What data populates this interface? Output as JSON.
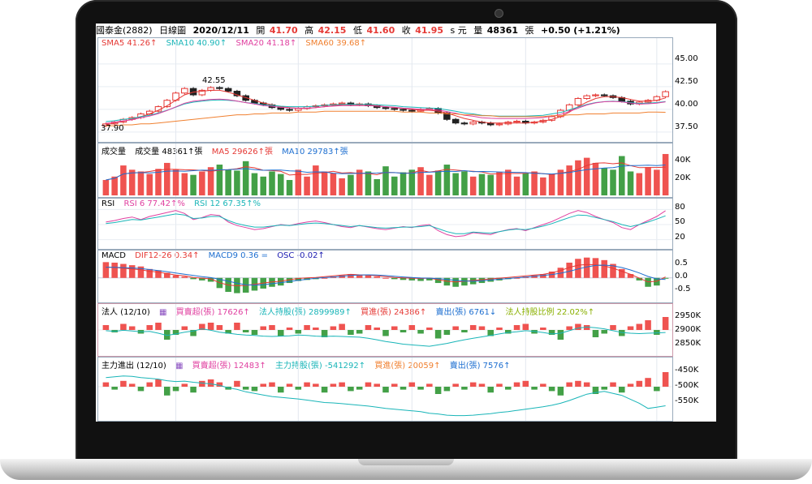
{
  "header": {
    "stock": "國泰金(2882)",
    "period": "日線圖",
    "date": "2020/12/11",
    "open_label": "開",
    "open": "41.70",
    "high_label": "高",
    "high": "42.15",
    "low_label": "低",
    "low": "41.60",
    "close_label": "收",
    "close": "41.95",
    "close_unit": "s 元",
    "volume_label": "量",
    "volume": "48361",
    "volume_unit": "張",
    "change": "+0.50 (+1.21%)"
  },
  "colors": {
    "up": "#e53935",
    "down": "#2e9e3e",
    "sma5": "#e53935",
    "sma10": "#19b5b8",
    "sma20": "#e040a0",
    "sma60": "#f08030"
  },
  "price_panel": {
    "legend": [
      "SMA5 41.26↑",
      "SMA10 40.90↑",
      "SMA20 41.18↑",
      "SMA60 39.68↑"
    ],
    "ticks": [
      "45.00",
      "42.50",
      "40.00",
      "37.50"
    ],
    "annotations": {
      "high": "42.55",
      "low": "37.90"
    }
  },
  "volume_panel": {
    "legend": [
      "成交量",
      "成交量 48361↑張",
      "MA5 29626↑張",
      "MA10 29783↑張"
    ],
    "ticks": [
      "40K",
      "20K"
    ]
  },
  "rsi_panel": {
    "legend": [
      "RSI",
      "RSI 6 77.42↑%",
      "RSI 12 67.35↑%"
    ],
    "ticks": [
      "80",
      "50",
      "20"
    ]
  },
  "macd_panel": {
    "legend": [
      "MACD",
      "DIF12-26 0.34↑",
      "MACD9 0.36 =",
      "OSC -0.02↑"
    ],
    "ticks": [
      "0.5",
      "0.0",
      "-0.5"
    ]
  },
  "inst_panel": {
    "legend": [
      "法人 (12/10)",
      "買賣超(張) 17626↑",
      "法人持股(張) 2899989↑",
      "買進(張) 24386↑",
      "賣出(張) 6761↓",
      "法人持股比例 22.02%↑"
    ],
    "ticks": [
      "2950K",
      "2900K",
      "2850K"
    ]
  },
  "main_panel": {
    "legend": [
      "主力進出 (12/10)",
      "買賣超(張) 12483↑",
      "主力持股(張) -541292↑",
      "買進(張) 20059↑",
      "賣出(張) 7576↑"
    ],
    "ticks": [
      "-450K",
      "-500K",
      "-550K"
    ]
  },
  "chart_data": {
    "type": "line",
    "title": "國泰金(2882) 日線圖",
    "ylim": [
      37.5,
      45.0
    ],
    "series": [
      {
        "name": "Close",
        "values": [
          38.4,
          38.6,
          38.9,
          39.1,
          39.5,
          39.8,
          40.3,
          41.0,
          41.8,
          42.3,
          41.6,
          42.1,
          42.4,
          42.3,
          42.0,
          41.5,
          41.0,
          40.7,
          40.5,
          40.2,
          40.0,
          39.9,
          40.1,
          40.3,
          40.4,
          40.5,
          40.6,
          40.7,
          40.5,
          40.6,
          40.4,
          40.2,
          40.1,
          40.0,
          39.9,
          39.8,
          40.0,
          40.1,
          39.6,
          38.9,
          38.5,
          38.4,
          38.6,
          38.5,
          38.3,
          38.4,
          38.6,
          38.7,
          38.5,
          38.6,
          38.8,
          39.2,
          39.9,
          40.5,
          41.2,
          41.5,
          41.6,
          41.5,
          41.3,
          40.9,
          40.6,
          40.8,
          41.0,
          41.4,
          41.95
        ]
      },
      {
        "name": "SMA5",
        "values": [
          38.3,
          38.5,
          38.7,
          38.9,
          39.2,
          39.5,
          39.9,
          40.4,
          41.0,
          41.6,
          41.9,
          42.0,
          42.1,
          42.1,
          41.9,
          41.6,
          41.3,
          41.0,
          40.7,
          40.5,
          40.3,
          40.2,
          40.1,
          40.1,
          40.2,
          40.3,
          40.4,
          40.5,
          40.5,
          40.5,
          40.5,
          40.4,
          40.3,
          40.2,
          40.1,
          40.0,
          39.9,
          39.9,
          39.8,
          39.6,
          39.3,
          39.0,
          38.8,
          38.6,
          38.5,
          38.5,
          38.5,
          38.5,
          38.5,
          38.6,
          38.7,
          38.9,
          39.2,
          39.7,
          40.3,
          40.8,
          41.2,
          41.4,
          41.4,
          41.3,
          41.1,
          40.9,
          40.9,
          41.0,
          41.26
        ]
      },
      {
        "name": "SMA60",
        "values": [
          38.2,
          38.2,
          38.3,
          38.3,
          38.4,
          38.4,
          38.5,
          38.6,
          38.7,
          38.8,
          38.9,
          39.0,
          39.1,
          39.2,
          39.3,
          39.4,
          39.4,
          39.5,
          39.5,
          39.6,
          39.6,
          39.6,
          39.7,
          39.7,
          39.7,
          39.8,
          39.8,
          39.8,
          39.8,
          39.8,
          39.8,
          39.8,
          39.8,
          39.8,
          39.7,
          39.7,
          39.7,
          39.6,
          39.6,
          39.5,
          39.5,
          39.4,
          39.4,
          39.3,
          39.3,
          39.2,
          39.2,
          39.2,
          39.2,
          39.2,
          39.2,
          39.3,
          39.3,
          39.4,
          39.4,
          39.5,
          39.5,
          39.5,
          39.6,
          39.6,
          39.6,
          39.6,
          39.7,
          39.7,
          39.68
        ]
      }
    ],
    "volume": [
      18,
      22,
      35,
      30,
      28,
      25,
      31,
      38,
      30,
      26,
      24,
      28,
      33,
      36,
      30,
      29,
      40,
      26,
      22,
      28,
      25,
      18,
      30,
      22,
      35,
      28,
      26,
      20,
      24,
      30,
      28,
      19,
      34,
      22,
      27,
      30,
      33,
      24,
      29,
      36,
      26,
      28,
      22,
      25,
      24,
      27,
      30,
      22,
      26,
      28,
      21,
      25,
      30,
      35,
      41,
      44,
      38,
      32,
      30,
      46,
      28,
      26,
      33,
      30,
      48.4
    ],
    "rsi6": [
      55,
      58,
      62,
      65,
      60,
      66,
      70,
      74,
      78,
      72,
      60,
      64,
      70,
      68,
      55,
      48,
      44,
      40,
      42,
      46,
      50,
      48,
      52,
      55,
      57,
      54,
      50,
      46,
      44,
      48,
      45,
      42,
      40,
      43,
      46,
      44,
      48,
      50,
      38,
      30,
      26,
      28,
      34,
      32,
      30,
      36,
      40,
      42,
      38,
      44,
      50,
      56,
      64,
      72,
      78,
      74,
      66,
      60,
      54,
      44,
      40,
      50,
      58,
      66,
      77.42
    ],
    "rsi12": [
      52,
      54,
      57,
      60,
      59,
      62,
      65,
      68,
      71,
      69,
      62,
      63,
      66,
      66,
      58,
      52,
      48,
      45,
      45,
      47,
      49,
      48,
      50,
      52,
      53,
      52,
      50,
      48,
      46,
      48,
      46,
      44,
      43,
      44,
      45,
      45,
      46,
      48,
      42,
      36,
      32,
      32,
      35,
      34,
      33,
      36,
      39,
      41,
      40,
      43,
      47,
      52,
      58,
      64,
      69,
      68,
      64,
      60,
      56,
      50,
      46,
      50,
      55,
      61,
      67.35
    ],
    "osc": [
      0.62,
      0.6,
      0.55,
      0.5,
      0.45,
      0.35,
      0.3,
      0.2,
      0.1,
      0.05,
      -0.05,
      -0.1,
      -0.15,
      -0.4,
      -0.55,
      -0.6,
      -0.58,
      -0.5,
      -0.42,
      -0.35,
      -0.3,
      -0.2,
      -0.12,
      -0.08,
      -0.05,
      0.0,
      0.05,
      0.1,
      0.15,
      0.12,
      0.1,
      0.05,
      0.0,
      -0.05,
      -0.08,
      -0.1,
      -0.12,
      -0.1,
      -0.2,
      -0.3,
      -0.35,
      -0.3,
      -0.25,
      -0.2,
      -0.15,
      -0.1,
      -0.05,
      0.0,
      0.05,
      0.1,
      0.15,
      0.25,
      0.4,
      0.6,
      0.75,
      0.8,
      0.78,
      0.7,
      0.55,
      0.35,
      0.15,
      -0.1,
      -0.35,
      -0.3,
      -0.02
    ],
    "inst_net": [
      4,
      -2,
      5,
      3,
      -3,
      4,
      6,
      -8,
      -4,
      3,
      -5,
      5,
      6,
      4,
      -3,
      6,
      -2,
      -4,
      3,
      4,
      -5,
      2,
      -3,
      4,
      2,
      -6,
      3,
      5,
      -4,
      -3,
      4,
      2,
      -5,
      3,
      -2,
      4,
      -3,
      2,
      -7,
      -4,
      3,
      -2,
      4,
      3,
      -5,
      2,
      -3,
      4,
      5,
      -3,
      2,
      -4,
      -8,
      3,
      5,
      4,
      -6,
      -3,
      4,
      -5,
      3,
      5,
      8,
      -4,
      17.6
    ],
    "inst_hold": [
      2905,
      2903,
      2906,
      2904,
      2902,
      2903,
      2898,
      2892,
      2896,
      2901,
      2904,
      2910,
      2906,
      2901,
      2898,
      2895,
      2893,
      2892,
      2890,
      2889,
      2890,
      2891,
      2893,
      2892,
      2890,
      2889,
      2890,
      2889,
      2888,
      2887,
      2884,
      2880,
      2875,
      2872,
      2868,
      2866,
      2864,
      2862,
      2866,
      2870,
      2875,
      2880,
      2884,
      2888,
      2892,
      2896,
      2900,
      2902,
      2905,
      2903,
      2900,
      2896,
      2898,
      2905,
      2912,
      2915,
      2913,
      2910,
      2905,
      2900,
      2898,
      2897,
      2898,
      2899,
      2899.989
    ],
    "main_net": [
      3,
      -2,
      4,
      2,
      -3,
      3,
      5,
      -6,
      -3,
      2,
      -4,
      4,
      5,
      3,
      -2,
      4,
      -2,
      -3,
      2,
      3,
      -4,
      2,
      -2,
      3,
      2,
      -4,
      2,
      3,
      -3,
      -2,
      3,
      2,
      -4,
      2,
      -2,
      3,
      -2,
      2,
      -5,
      -3,
      2,
      -2,
      3,
      2,
      -4,
      2,
      -2,
      3,
      4,
      -2,
      2,
      -3,
      -6,
      3,
      4,
      3,
      -5,
      -2,
      3,
      -4,
      2,
      4,
      6,
      -3,
      12.5
    ],
    "main_hold": [
      -470,
      -468,
      -466,
      -467,
      -470,
      -472,
      -474,
      -478,
      -480,
      -479,
      -482,
      -484,
      -486,
      -490,
      -496,
      -500,
      -506,
      -510,
      -514,
      -518,
      -520,
      -522,
      -524,
      -527,
      -530,
      -533,
      -534,
      -536,
      -538,
      -540,
      -542,
      -545,
      -548,
      -550,
      -552,
      -554,
      -556,
      -560,
      -562,
      -565,
      -566,
      -566,
      -565,
      -563,
      -561,
      -558,
      -556,
      -553,
      -550,
      -547,
      -544,
      -540,
      -535,
      -528,
      -520,
      -512,
      -508,
      -505,
      -510,
      -515,
      -525,
      -535,
      -548,
      -545,
      -541.3
    ]
  }
}
